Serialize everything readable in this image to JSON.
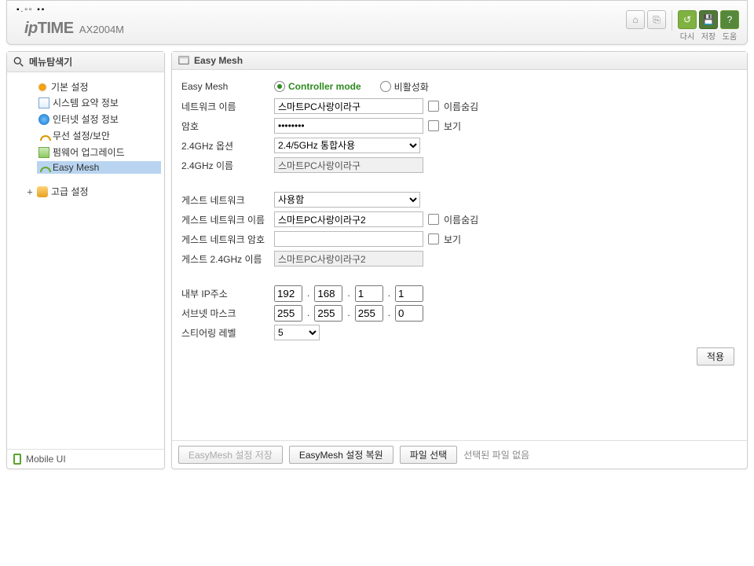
{
  "header": {
    "logo_ip": "ip",
    "logo_time": "TIME",
    "model": "AX2004M",
    "btn_home": "⌂",
    "btn_logout": "⎘",
    "btn_reload": "↺",
    "btn_save": "💾",
    "btn_help": "?",
    "lbl_reload": "다시",
    "lbl_save": "저장",
    "lbl_help": "도움"
  },
  "sidebar": {
    "title": "메뉴탐색기",
    "basic": {
      "label": "기본 설정",
      "sys": "시스템 요약 정보",
      "inet": "인터넷 설정 정보",
      "wlan": "무선 설정/보안",
      "fw": "펌웨어 업그레이드",
      "mesh": "Easy Mesh"
    },
    "adv_label": "고급 설정",
    "mobile": "Mobile UI"
  },
  "panel": {
    "title": "Easy Mesh",
    "rows": {
      "mode_lbl": "Easy Mesh",
      "mode_ctrl": "Controller mode",
      "mode_off": "비활성화",
      "ssid_lbl": "네트워크 이름",
      "ssid_val": "스마트PC사랑이라구",
      "ssid_hide": "이름숨김",
      "pw_lbl": "암호",
      "pw_show": "보기",
      "opt24_lbl": "2.4GHz 옵션",
      "opt24_val": "2.4/5GHz 통합사용",
      "name24_lbl": "2.4GHz 이름",
      "name24_val": "스마트PC사랑이라구",
      "guest_lbl": "게스트 네트워크",
      "guest_val": "사용함",
      "gssid_lbl": "게스트 네트워크 이름",
      "gssid_val": "스마트PC사랑이라구2",
      "gssid_hide": "이름숨김",
      "gpw_lbl": "게스트 네트워크 암호",
      "gpw_val": "",
      "gpw_show": "보기",
      "gname24_lbl": "게스트 2.4GHz 이름",
      "gname24_val": "스마트PC사랑이라구2",
      "ip_lbl": "내부 IP주소",
      "ip": [
        "192",
        "168",
        "1",
        "1"
      ],
      "mask_lbl": "서브넷 마스크",
      "mask": [
        "255",
        "255",
        "255",
        "0"
      ],
      "steer_lbl": "스티어링 레벨",
      "steer_val": "5",
      "apply": "적용"
    },
    "footer": {
      "save_cfg": "EasyMesh 설정 저장",
      "restore_cfg": "EasyMesh 설정 복원",
      "file_btn": "파일 선택",
      "file_none": "선택된 파일 없음"
    }
  }
}
